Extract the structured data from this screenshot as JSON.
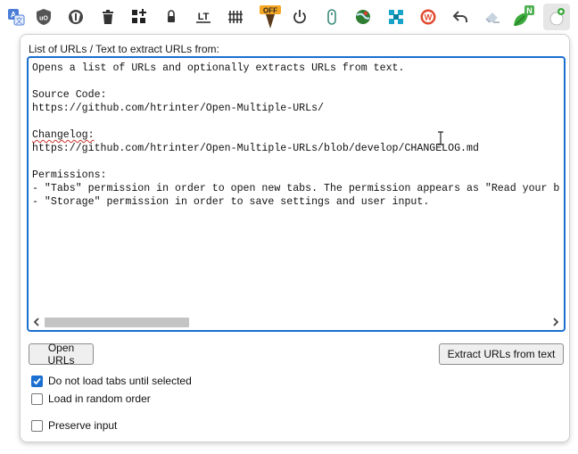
{
  "toolbar": {
    "extensions": [
      {
        "icon": "translate-icon"
      },
      {
        "icon": "ublock-icon"
      },
      {
        "icon": "privacy-badger-icon"
      },
      {
        "icon": "trash-icon"
      },
      {
        "icon": "grid-plus-icon"
      },
      {
        "icon": "lock-icon"
      },
      {
        "icon": "languagetool-icon",
        "text": "LT"
      },
      {
        "icon": "fence-icon"
      },
      {
        "icon": "off-badge-icon",
        "badge": "OFF"
      },
      {
        "icon": "power-icon"
      },
      {
        "icon": "mouse-icon"
      },
      {
        "icon": "globe-icon"
      },
      {
        "icon": "puzzle-cross-icon"
      },
      {
        "icon": "w-circle-icon",
        "text": "W"
      },
      {
        "icon": "undo-arrow-icon"
      },
      {
        "icon": "eraser-icon"
      },
      {
        "icon": "leaf-n-icon",
        "badge": "N"
      },
      {
        "icon": "open-multiple-urls-icon"
      }
    ]
  },
  "popup": {
    "list_label": "List of URLs / Text to extract URLs from:",
    "text_lines": [
      "Opens a list of URLs and optionally extracts URLs from text.",
      "",
      "Source Code:",
      "https://github.com/htrinter/Open-Multiple-URLs/",
      "",
      "Changelog:",
      "https://github.com/htrinter/Open-Multiple-URLs/blob/develop/CHANGELOG.md",
      "",
      "Permissions:",
      "- \"Tabs\" permission in order to open new tabs. The permission appears as \"Read your browsing history\".",
      "- \"Storage\" permission in order to save settings and user input."
    ],
    "open_urls_label": "Open URLs",
    "extract_label": "Extract URLs from text",
    "options": [
      {
        "label": "Do not load tabs until selected",
        "checked": true
      },
      {
        "label": "Load in random order",
        "checked": false
      },
      {
        "label": "Preserve input",
        "checked": false
      }
    ]
  },
  "colors": {
    "accent": "#1a6fd0",
    "button_bg": "#efefef",
    "ublock": "#800000",
    "off_badge": "#f5a623",
    "w_circle": "#e04a2f",
    "leaf": "#3aa93a",
    "badge_green": "#4caf50"
  }
}
